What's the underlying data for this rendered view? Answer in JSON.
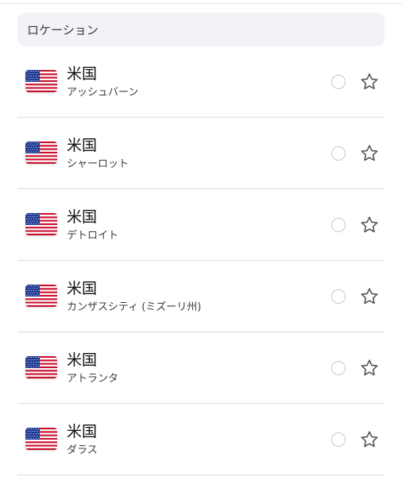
{
  "section": {
    "title": "ロケーション"
  },
  "locations": [
    {
      "country": "米国",
      "city": "アッシュバーン",
      "flag": "us-flag-icon"
    },
    {
      "country": "米国",
      "city": "シャーロット",
      "flag": "us-flag-icon"
    },
    {
      "country": "米国",
      "city": "デトロイト",
      "flag": "us-flag-icon"
    },
    {
      "country": "米国",
      "city": "カンザスシティ (ミズーリ州)",
      "flag": "us-flag-icon"
    },
    {
      "country": "米国",
      "city": "アトランタ",
      "flag": "us-flag-icon"
    },
    {
      "country": "米国",
      "city": "ダラス",
      "flag": "us-flag-icon"
    }
  ],
  "colors": {
    "header_bg": "#f2f2f7",
    "divider": "#dcdce0",
    "radio_border": "#c7c7cc",
    "star_stroke": "#555555",
    "flag_red": "#c8102e",
    "flag_blue": "#1f3a93"
  }
}
